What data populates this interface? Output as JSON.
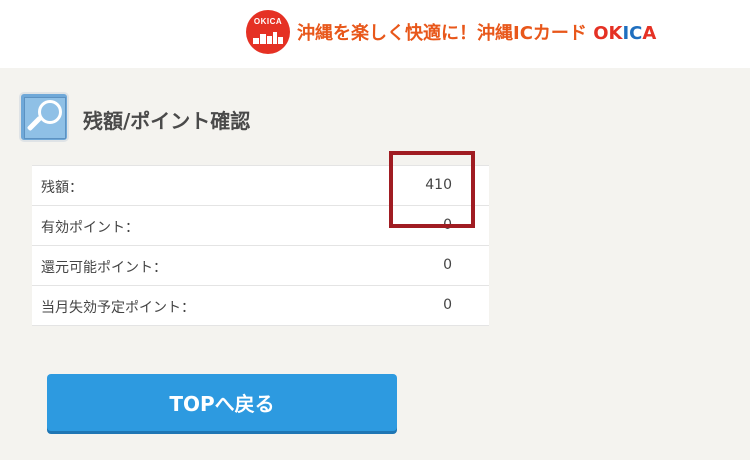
{
  "header": {
    "logo_text": "OKICA",
    "tagline_main": "沖縄を楽しく快適に！沖縄ICカード ",
    "tagline_ok": "OK",
    "tagline_ic": "IC",
    "tagline_a": "A"
  },
  "section": {
    "icon": "search-icon",
    "title": "残額/ポイント確認"
  },
  "balance": {
    "rows": [
      {
        "label": "残額：",
        "value": "410"
      },
      {
        "label": "有効ポイント：",
        "value": "0"
      },
      {
        "label": "還元可能ポイント：",
        "value": "0"
      },
      {
        "label": "当月失効予定ポイント：",
        "value": "0"
      }
    ],
    "highlight_color": "#a01c22"
  },
  "actions": {
    "top_button_label": "TOPへ戻る",
    "accent": "#2d9ae0"
  }
}
